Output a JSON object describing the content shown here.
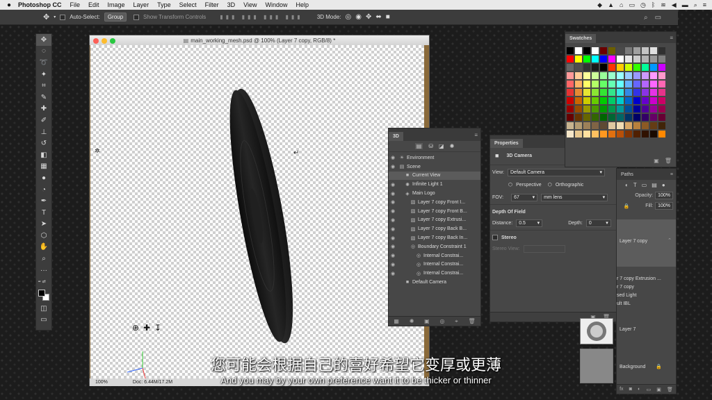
{
  "menubar": {
    "app_name": "Photoshop CC",
    "items": [
      "File",
      "Edit",
      "Image",
      "Layer",
      "Type",
      "Select",
      "Filter",
      "3D",
      "View",
      "Window",
      "Help"
    ]
  },
  "options": {
    "auto_select_label": "Auto-Select:",
    "auto_select_value": "Group",
    "transform_controls_label": "Show Transform Controls",
    "mode_3d_label": "3D Mode:"
  },
  "document": {
    "title": "main_working_mesh.psd @ 100% (Layer 7 copy, RGB/8) *",
    "zoom": "100%",
    "doc_info": "Doc: 6.44M/17.2M"
  },
  "panel3d": {
    "tab": "3D",
    "items": [
      {
        "label": "Environment",
        "indent": 0,
        "icon": "environment-icon",
        "glyph": "☀",
        "eye": true,
        "selected": false
      },
      {
        "label": "Scene",
        "indent": 0,
        "icon": "scene-icon",
        "glyph": "▤",
        "eye": true,
        "selected": false
      },
      {
        "label": "Current View",
        "indent": 1,
        "icon": "camera-icon",
        "glyph": "■",
        "eye": false,
        "selected": true
      },
      {
        "label": "Infinite Light 1",
        "indent": 1,
        "icon": "light-icon",
        "glyph": "✺",
        "eye": true,
        "selected": false
      },
      {
        "label": "Main Logo",
        "indent": 1,
        "icon": "mesh-group-icon",
        "glyph": "◈",
        "eye": true,
        "selected": false
      },
      {
        "label": "Layer 7 copy Front I...",
        "indent": 2,
        "icon": "material-icon",
        "glyph": "▧",
        "eye": true,
        "selected": false
      },
      {
        "label": "Layer 7 copy Front B...",
        "indent": 2,
        "icon": "material-icon",
        "glyph": "▧",
        "eye": true,
        "selected": false
      },
      {
        "label": "Layer 7 copy Extrusi...",
        "indent": 2,
        "icon": "material-icon",
        "glyph": "▧",
        "eye": true,
        "selected": false
      },
      {
        "label": "Layer 7 copy Back B...",
        "indent": 2,
        "icon": "material-icon",
        "glyph": "▧",
        "eye": true,
        "selected": false
      },
      {
        "label": "Layer 7 copy Back In...",
        "indent": 2,
        "icon": "material-icon",
        "glyph": "▧",
        "eye": true,
        "selected": false
      },
      {
        "label": "Boundary Constraint 1",
        "indent": 2,
        "icon": "constraint-icon",
        "glyph": "◎",
        "eye": true,
        "selected": false
      },
      {
        "label": "Internal Constrai...",
        "indent": 3,
        "icon": "constraint-icon",
        "glyph": "◎",
        "eye": true,
        "selected": false
      },
      {
        "label": "Internal Constrai...",
        "indent": 3,
        "icon": "constraint-icon",
        "glyph": "◎",
        "eye": true,
        "selected": false
      },
      {
        "label": "Internal Constrai...",
        "indent": 3,
        "icon": "constraint-icon",
        "glyph": "◎",
        "eye": true,
        "selected": false
      },
      {
        "label": "Default Camera",
        "indent": 1,
        "icon": "camera-icon",
        "glyph": "■",
        "eye": false,
        "selected": false
      }
    ]
  },
  "properties": {
    "tab": "Properties",
    "header": "3D Camera",
    "view_label": "View:",
    "view_value": "Default Camera",
    "perspective_label": "Perspective",
    "orthographic_label": "Orthographic",
    "fov_label": "FOV:",
    "fov_value": "67",
    "lens_value": "mm lens",
    "dof_label": "Depth Of Field",
    "distance_label": "Distance:",
    "distance_value": "0.5",
    "depth_label": "Depth:",
    "depth_value": "0",
    "stereo_label": "Stereo",
    "stereo_view_label": "Stereo View:"
  },
  "swatches": {
    "tab": "Swatches",
    "colors": [
      [
        "#000000",
        "#ffffff",
        "#000000",
        "#ffffff",
        "#6b0000",
        "#6b5e00",
        "#4a4a4a",
        "#7a7a7a",
        "#a0a0a0",
        "#c4c4c4",
        "#e0e0e0",
        "#303030"
      ],
      [
        "#ff0000",
        "#ffff00",
        "#00ff00",
        "#00ffff",
        "#0000ff",
        "#ff00ff",
        "#ffffff",
        "#e6e6e6",
        "#cccccc",
        "#b3b3b3",
        "#999999",
        "#808080"
      ],
      [
        "#666666",
        "#4d4d4d",
        "#333333",
        "#1a1a1a",
        "#000000",
        "#ff3300",
        "#ffcc00",
        "#ccff00",
        "#33ff00",
        "#00ff99",
        "#0099ff",
        "#cc00ff"
      ],
      [
        "#ff9999",
        "#ffcc99",
        "#ffff99",
        "#ccff99",
        "#99ff99",
        "#99ffcc",
        "#99ffff",
        "#99ccff",
        "#9999ff",
        "#cc99ff",
        "#ff99ff",
        "#ff99cc"
      ],
      [
        "#ff6666",
        "#ffb366",
        "#ffff66",
        "#b3ff66",
        "#66ff66",
        "#66ffb3",
        "#66ffff",
        "#66b3ff",
        "#6666ff",
        "#b366ff",
        "#ff66ff",
        "#ff66b3"
      ],
      [
        "#e63333",
        "#e68a33",
        "#e6e633",
        "#8ae633",
        "#33e633",
        "#33e68a",
        "#33e6e6",
        "#338ae6",
        "#3333e6",
        "#8a33e6",
        "#e633e6",
        "#e6338a"
      ],
      [
        "#cc0000",
        "#cc6600",
        "#cccc00",
        "#66cc00",
        "#00cc00",
        "#00cc66",
        "#00cccc",
        "#0066cc",
        "#0000cc",
        "#6600cc",
        "#cc00cc",
        "#cc0066"
      ],
      [
        "#990000",
        "#994d00",
        "#999900",
        "#4d9900",
        "#009900",
        "#00994d",
        "#009999",
        "#004d99",
        "#000099",
        "#4d0099",
        "#990099",
        "#99004d"
      ],
      [
        "#660000",
        "#663300",
        "#666600",
        "#336600",
        "#006600",
        "#006633",
        "#006666",
        "#003366",
        "#000066",
        "#330066",
        "#660066",
        "#660033"
      ],
      [
        "#c8b490",
        "#b39b72",
        "#9c8058",
        "#806445",
        "#5e4a33",
        "#e0c8a0",
        "#f0dcb4",
        "#d8a868",
        "#b8803c",
        "#8c5a24",
        "#643c14",
        "#402408"
      ],
      [
        "#f5e6c8",
        "#e8c890",
        "#ffe0a0",
        "#ffc060",
        "#ff9820",
        "#e07010",
        "#b85008",
        "#803404",
        "#502002",
        "#301200",
        "#1a0a00",
        "#ff8800"
      ]
    ]
  },
  "layers": {
    "paths_tab": "Paths",
    "opacity_label": "Opacity:",
    "opacity_value": "100%",
    "fill_label": "Fill:",
    "fill_value": "100%",
    "layer_selected": "Layer 7 copy",
    "sublayers": [
      "r 7 copy Extrusion ...",
      "r 7 copy",
      "sed Light",
      "ult IBL"
    ],
    "layer7": "Layer 7",
    "background": "Background"
  },
  "subtitles": {
    "cn": "您可能会根据自己的喜好希望它变厚或更薄",
    "en": "And you may by your own preference want it to be thicker or thinner"
  }
}
